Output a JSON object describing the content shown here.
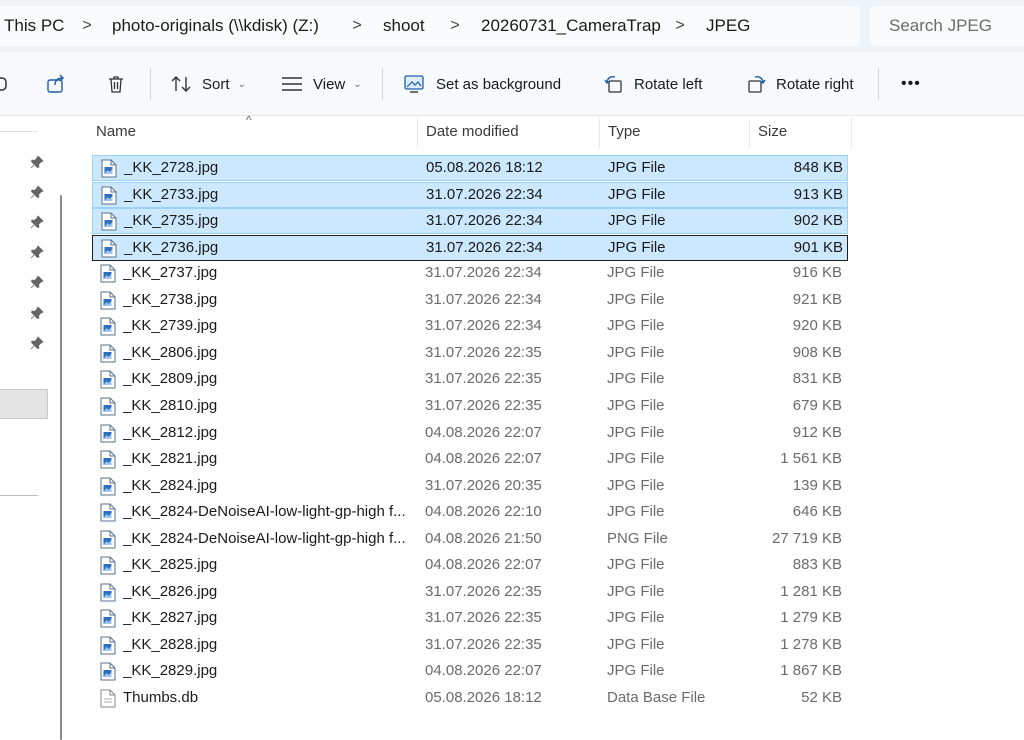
{
  "address": {
    "crumbs": [
      "This PC",
      "photo-originals (\\\\kdisk) (Z:)",
      "shoot",
      "20260731_CameraTrap",
      "JPEG"
    ],
    "separator": ">"
  },
  "search": {
    "placeholder": "Search JPEG"
  },
  "toolbar": {
    "sort_label": "Sort",
    "view_label": "View",
    "set_background_label": "Set as background",
    "rotate_left_label": "Rotate left",
    "rotate_right_label": "Rotate right",
    "more_label": "•••",
    "dropdown_glyph": "⌄"
  },
  "columns": {
    "name": "Name",
    "date": "Date modified",
    "type": "Type",
    "size": "Size",
    "sort_indicator": "^"
  },
  "files": [
    {
      "name": "_KK_2728.jpg",
      "date": "05.08.2026 18:12",
      "type": "JPG File",
      "size": "848 KB",
      "selected": true,
      "icon": "image-file-icon"
    },
    {
      "name": "_KK_2733.jpg",
      "date": "31.07.2026 22:34",
      "type": "JPG File",
      "size": "913 KB",
      "selected": true,
      "icon": "image-file-icon"
    },
    {
      "name": "_KK_2735.jpg",
      "date": "31.07.2026 22:34",
      "type": "JPG File",
      "size": "902 KB",
      "selected": true,
      "icon": "image-file-icon"
    },
    {
      "name": "_KK_2736.jpg",
      "date": "31.07.2026 22:34",
      "type": "JPG File",
      "size": "901 KB",
      "selected": true,
      "focused": true,
      "icon": "image-file-icon"
    },
    {
      "name": "_KK_2737.jpg",
      "date": "31.07.2026 22:34",
      "type": "JPG File",
      "size": "916 KB",
      "icon": "image-file-icon"
    },
    {
      "name": "_KK_2738.jpg",
      "date": "31.07.2026 22:34",
      "type": "JPG File",
      "size": "921 KB",
      "icon": "image-file-icon"
    },
    {
      "name": "_KK_2739.jpg",
      "date": "31.07.2026 22:34",
      "type": "JPG File",
      "size": "920 KB",
      "icon": "image-file-icon"
    },
    {
      "name": "_KK_2806.jpg",
      "date": "31.07.2026 22:35",
      "type": "JPG File",
      "size": "908 KB",
      "icon": "image-file-icon"
    },
    {
      "name": "_KK_2809.jpg",
      "date": "31.07.2026 22:35",
      "type": "JPG File",
      "size": "831 KB",
      "icon": "image-file-icon"
    },
    {
      "name": "_KK_2810.jpg",
      "date": "31.07.2026 22:35",
      "type": "JPG File",
      "size": "679 KB",
      "icon": "image-file-icon"
    },
    {
      "name": "_KK_2812.jpg",
      "date": "04.08.2026 22:07",
      "type": "JPG File",
      "size": "912 KB",
      "icon": "image-file-icon"
    },
    {
      "name": "_KK_2821.jpg",
      "date": "04.08.2026 22:07",
      "type": "JPG File",
      "size": "1 561 KB",
      "icon": "image-file-icon"
    },
    {
      "name": "_KK_2824.jpg",
      "date": "31.07.2026 20:35",
      "type": "JPG File",
      "size": "139 KB",
      "icon": "image-file-icon"
    },
    {
      "name": "_KK_2824-DeNoiseAI-low-light-gp-high f...",
      "date": "04.08.2026 22:10",
      "type": "JPG File",
      "size": "646 KB",
      "icon": "image-file-icon"
    },
    {
      "name": "_KK_2824-DeNoiseAI-low-light-gp-high f...",
      "date": "04.08.2026 21:50",
      "type": "PNG File",
      "size": "27 719 KB",
      "icon": "image-file-icon"
    },
    {
      "name": "_KK_2825.jpg",
      "date": "04.08.2026 22:07",
      "type": "JPG File",
      "size": "883 KB",
      "icon": "image-file-icon"
    },
    {
      "name": "_KK_2826.jpg",
      "date": "31.07.2026 22:35",
      "type": "JPG File",
      "size": "1 281 KB",
      "icon": "image-file-icon"
    },
    {
      "name": "_KK_2827.jpg",
      "date": "31.07.2026 22:35",
      "type": "JPG File",
      "size": "1 279 KB",
      "icon": "image-file-icon"
    },
    {
      "name": "_KK_2828.jpg",
      "date": "31.07.2026 22:35",
      "type": "JPG File",
      "size": "1 278 KB",
      "icon": "image-file-icon"
    },
    {
      "name": "_KK_2829.jpg",
      "date": "04.08.2026 22:07",
      "type": "JPG File",
      "size": "1 867 KB",
      "icon": "image-file-icon"
    },
    {
      "name": "Thumbs.db",
      "date": "05.08.2026 18:12",
      "type": "Data Base File",
      "size": "52 KB",
      "icon": "database-file-icon"
    }
  ],
  "colors": {
    "selection_bg": "#cce8ff",
    "selection_border": "#99d1ff",
    "accent": "#0067c0"
  }
}
